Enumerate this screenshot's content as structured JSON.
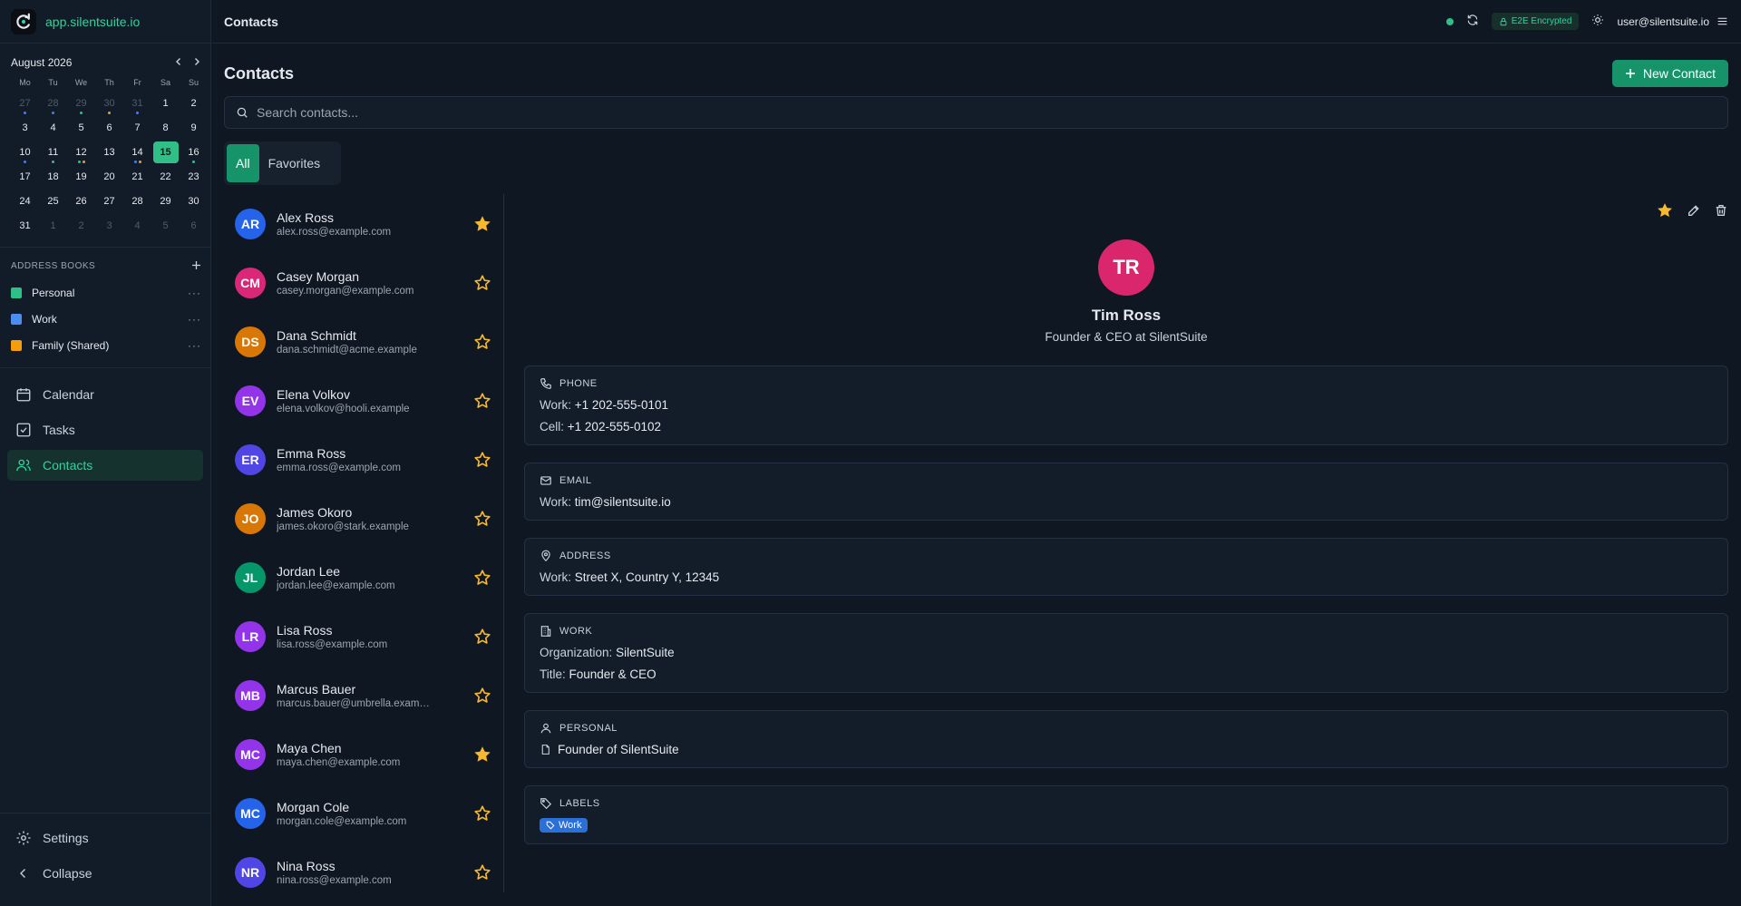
{
  "app": {
    "brand": "app.silentsuite.io"
  },
  "topbar": {
    "title": "Contacts",
    "e2e_label": "E2E Encrypted",
    "user": "user@silentsuite.io"
  },
  "mini_calendar": {
    "title": "August 2026",
    "weekdays": [
      "Mo",
      "Tu",
      "We",
      "Th",
      "Fr",
      "Sa",
      "Su"
    ],
    "days": [
      {
        "d": "27",
        "muted": true,
        "dots": [
          "#3b82f6"
        ]
      },
      {
        "d": "28",
        "muted": true,
        "dots": [
          "#3b82f6"
        ]
      },
      {
        "d": "29",
        "muted": true,
        "dots": [
          "#2fbf87"
        ]
      },
      {
        "d": "30",
        "muted": true,
        "dots": [
          "#f59e0b"
        ]
      },
      {
        "d": "31",
        "muted": true,
        "dots": [
          "#3b82f6"
        ]
      },
      {
        "d": "1"
      },
      {
        "d": "2"
      },
      {
        "d": "3"
      },
      {
        "d": "4"
      },
      {
        "d": "5"
      },
      {
        "d": "6"
      },
      {
        "d": "7"
      },
      {
        "d": "8"
      },
      {
        "d": "9"
      },
      {
        "d": "10",
        "dots": [
          "#3b82f6"
        ]
      },
      {
        "d": "11",
        "dots": [
          "#2fbf87"
        ]
      },
      {
        "d": "12",
        "dots": [
          "#2fbf87",
          "#f59e0b"
        ]
      },
      {
        "d": "13"
      },
      {
        "d": "14",
        "dots": [
          "#3b82f6",
          "#f59e0b"
        ]
      },
      {
        "d": "15",
        "today": true
      },
      {
        "d": "16",
        "dots": [
          "#2fbf87"
        ]
      },
      {
        "d": "17"
      },
      {
        "d": "18"
      },
      {
        "d": "19"
      },
      {
        "d": "20"
      },
      {
        "d": "21"
      },
      {
        "d": "22"
      },
      {
        "d": "23"
      },
      {
        "d": "24"
      },
      {
        "d": "25"
      },
      {
        "d": "26"
      },
      {
        "d": "27"
      },
      {
        "d": "28"
      },
      {
        "d": "29"
      },
      {
        "d": "30"
      },
      {
        "d": "31"
      },
      {
        "d": "1",
        "muted": true
      },
      {
        "d": "2",
        "muted": true
      },
      {
        "d": "3",
        "muted": true
      },
      {
        "d": "4",
        "muted": true
      },
      {
        "d": "5",
        "muted": true
      },
      {
        "d": "6",
        "muted": true
      }
    ]
  },
  "address_books": {
    "title": "ADDRESS BOOKS",
    "items": [
      {
        "label": "Personal",
        "color": "#2fbf87"
      },
      {
        "label": "Work",
        "color": "#4b8df0"
      },
      {
        "label": "Family (Shared)",
        "color": "#f59e0b"
      }
    ]
  },
  "nav": {
    "calendar": "Calendar",
    "tasks": "Tasks",
    "contacts": "Contacts",
    "settings": "Settings",
    "collapse": "Collapse"
  },
  "page": {
    "title": "Contacts",
    "new_button": "New Contact",
    "search_placeholder": "Search contacts...",
    "tabs": [
      "All",
      "Favorites"
    ]
  },
  "contacts": [
    {
      "initials": "AR",
      "name": "Alex Ross",
      "email": "alex.ross@example.com",
      "color": "#2563eb",
      "fav": true
    },
    {
      "initials": "CM",
      "name": "Casey Morgan",
      "email": "casey.morgan@example.com",
      "color": "#db2777",
      "fav": false
    },
    {
      "initials": "DS",
      "name": "Dana Schmidt",
      "email": "dana.schmidt@acme.example",
      "color": "#d97706",
      "fav": false
    },
    {
      "initials": "EV",
      "name": "Elena Volkov",
      "email": "elena.volkov@hooli.example",
      "color": "#9333ea",
      "fav": false
    },
    {
      "initials": "ER",
      "name": "Emma Ross",
      "email": "emma.ross@example.com",
      "color": "#4f46e5",
      "fav": false
    },
    {
      "initials": "JO",
      "name": "James Okoro",
      "email": "james.okoro@stark.example",
      "color": "#d97706",
      "fav": false
    },
    {
      "initials": "JL",
      "name": "Jordan Lee",
      "email": "jordan.lee@example.com",
      "color": "#059669",
      "fav": false
    },
    {
      "initials": "LR",
      "name": "Lisa Ross",
      "email": "lisa.ross@example.com",
      "color": "#9333ea",
      "fav": false
    },
    {
      "initials": "MB",
      "name": "Marcus Bauer",
      "email": "marcus.bauer@umbrella.example",
      "color": "#9333ea",
      "fav": false
    },
    {
      "initials": "MC",
      "name": "Maya Chen",
      "email": "maya.chen@example.com",
      "color": "#9333ea",
      "fav": true
    },
    {
      "initials": "MC",
      "name": "Morgan Cole",
      "email": "morgan.cole@example.com",
      "color": "#2563eb",
      "fav": false
    },
    {
      "initials": "NR",
      "name": "Nina Ross",
      "email": "nina.ross@example.com",
      "color": "#4f46e5",
      "fav": false
    }
  ],
  "detail": {
    "initials": "TR",
    "name": "Tim Ross",
    "subtitle": "Founder & CEO at SilentSuite",
    "phone": {
      "title": "PHONE",
      "work_k": "Work:",
      "work_v": "+1 202-555-0101",
      "cell_k": "Cell:",
      "cell_v": "+1 202-555-0102"
    },
    "email": {
      "title": "EMAIL",
      "work_k": "Work:",
      "work_v": "tim@silentsuite.io"
    },
    "address": {
      "title": "ADDRESS",
      "work_k": "Work:",
      "work_v": "Street X, Country Y, 12345"
    },
    "work": {
      "title": "WORK",
      "org_k": "Organization:",
      "org_v": "SilentSuite",
      "title_k": "Title:",
      "title_v": "Founder & CEO"
    },
    "personal": {
      "title": "PERSONAL",
      "note": "Founder of SilentSuite"
    },
    "labels": {
      "title": "LABELS",
      "chip": "Work"
    }
  },
  "colors": {
    "accent": "#17936a",
    "accent_text": "#2fd49a",
    "star": "#f5b82e"
  }
}
